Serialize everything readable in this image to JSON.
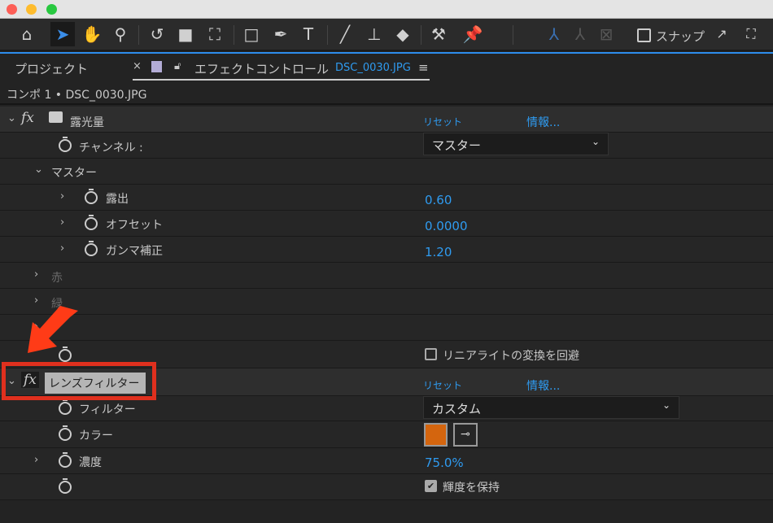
{
  "window": {
    "buttons": [
      "close",
      "minimize",
      "zoom"
    ]
  },
  "toolbar": {
    "tools": [
      "home-icon",
      "selection-icon",
      "hand-icon",
      "zoom-icon",
      "rotate-icon",
      "camera-icon",
      "pan-behind-icon",
      "rectangle-icon",
      "pen-icon",
      "text-icon",
      "brush-icon",
      "clone-stamp-icon",
      "eraser-icon",
      "roto-brush-icon",
      "puppet-pin-icon"
    ],
    "snap_label": "スナップ"
  },
  "tabs": {
    "project": "プロジェクト",
    "close": "×",
    "effect_controls": "エフェクトコントロール",
    "file": "DSC_0030.JPG",
    "menu": "≡"
  },
  "comp_line": "コンポ 1 • DSC_0030.JPG",
  "effects": {
    "exposure": {
      "name": "露光量",
      "reset": "リセット",
      "info": "情報...",
      "channel_label": "チャンネル :",
      "channel_value": "マスター",
      "master": "マスター",
      "params": [
        {
          "label": "露出",
          "value": "0.60"
        },
        {
          "label": "オフセット",
          "value": "0.0000"
        },
        {
          "label": "ガンマ補正",
          "value": "1.20"
        }
      ],
      "red": "赤",
      "green": "緑",
      "linear_label": "リニアライトの変換を回避",
      "linear_checked": false
    },
    "lens_filter": {
      "name": "レンズフィルター",
      "reset": "リセット",
      "info": "情報...",
      "filter_label": "フィルター",
      "filter_value": "カスタム",
      "color_label": "カラー",
      "color": "#d4650e",
      "density_label": "濃度",
      "density_value": "75.0%",
      "preserve_label": "輝度を保持",
      "preserve_checked": true
    }
  },
  "highlight_color": "#e0301e"
}
